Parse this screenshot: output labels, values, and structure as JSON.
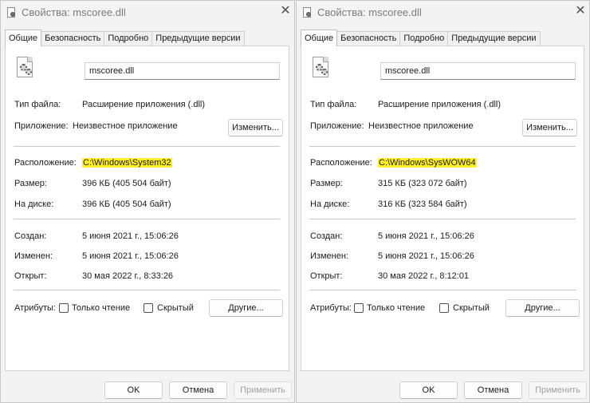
{
  "left": {
    "title": "Свойства: mscoree.dll",
    "close_glyph": "✕",
    "tabs": [
      "Общие",
      "Безопасность",
      "Подробно",
      "Предыдущие версии"
    ],
    "file_name": "mscoree.dll",
    "type_label": "Тип файла:",
    "type_value": "Расширение приложения (.dll)",
    "app_label": "Приложение:",
    "app_value": "Неизвестное приложение",
    "change_button": "Изменить...",
    "location_label": "Расположение:",
    "location_value": "C:\\Windows\\System32",
    "size_label": "Размер:",
    "size_value": "396 КБ (405 504 байт)",
    "disk_label": "На диске:",
    "disk_value": "396 КБ (405 504 байт)",
    "created_label": "Создан:",
    "created_value": "5 июня 2021 г., 15:06:26",
    "modified_label": "Изменен:",
    "modified_value": "5 июня 2021 г., 15:06:26",
    "accessed_label": "Открыт:",
    "accessed_value": "30 мая 2022 г., 8:33:26",
    "attributes_label": "Атрибуты:",
    "readonly_label": "Только чтение",
    "readonly_checked": false,
    "hidden_label": "Скрытый",
    "hidden_checked": false,
    "other_button": "Другие...",
    "ok_button": "OK",
    "cancel_button": "Отмена",
    "apply_button": "Применить"
  },
  "right": {
    "title": "Свойства: mscoree.dll",
    "close_glyph": "✕",
    "tabs": [
      "Общие",
      "Безопасность",
      "Подробно",
      "Предыдущие версии"
    ],
    "file_name": "mscoree.dll",
    "type_label": "Тип файла:",
    "type_value": "Расширение приложения (.dll)",
    "app_label": "Приложение:",
    "app_value": "Неизвестное приложение",
    "change_button": "Изменить...",
    "location_label": "Расположение:",
    "location_value": "C:\\Windows\\SysWOW64",
    "size_label": "Размер:",
    "size_value": "315 КБ (323 072 байт)",
    "disk_label": "На диске:",
    "disk_value": "316 КБ (323 584 байт)",
    "created_label": "Создан:",
    "created_value": "5 июня 2021 г., 15:06:26",
    "modified_label": "Изменен:",
    "modified_value": "5 июня 2021 г., 15:06:26",
    "accessed_label": "Открыт:",
    "accessed_value": "30 мая 2022 г., 8:12:01",
    "attributes_label": "Атрибуты:",
    "readonly_label": "Только чтение",
    "readonly_checked": false,
    "hidden_label": "Скрытый",
    "hidden_checked": false,
    "other_button": "Другие...",
    "ok_button": "OK",
    "cancel_button": "Отмена",
    "apply_button": "Применить"
  },
  "colors": {
    "highlight": "#ffef2a",
    "window_bg": "#f3f3f3",
    "panel_bg": "#ffffff",
    "disabled_text": "#a0a0a0"
  }
}
